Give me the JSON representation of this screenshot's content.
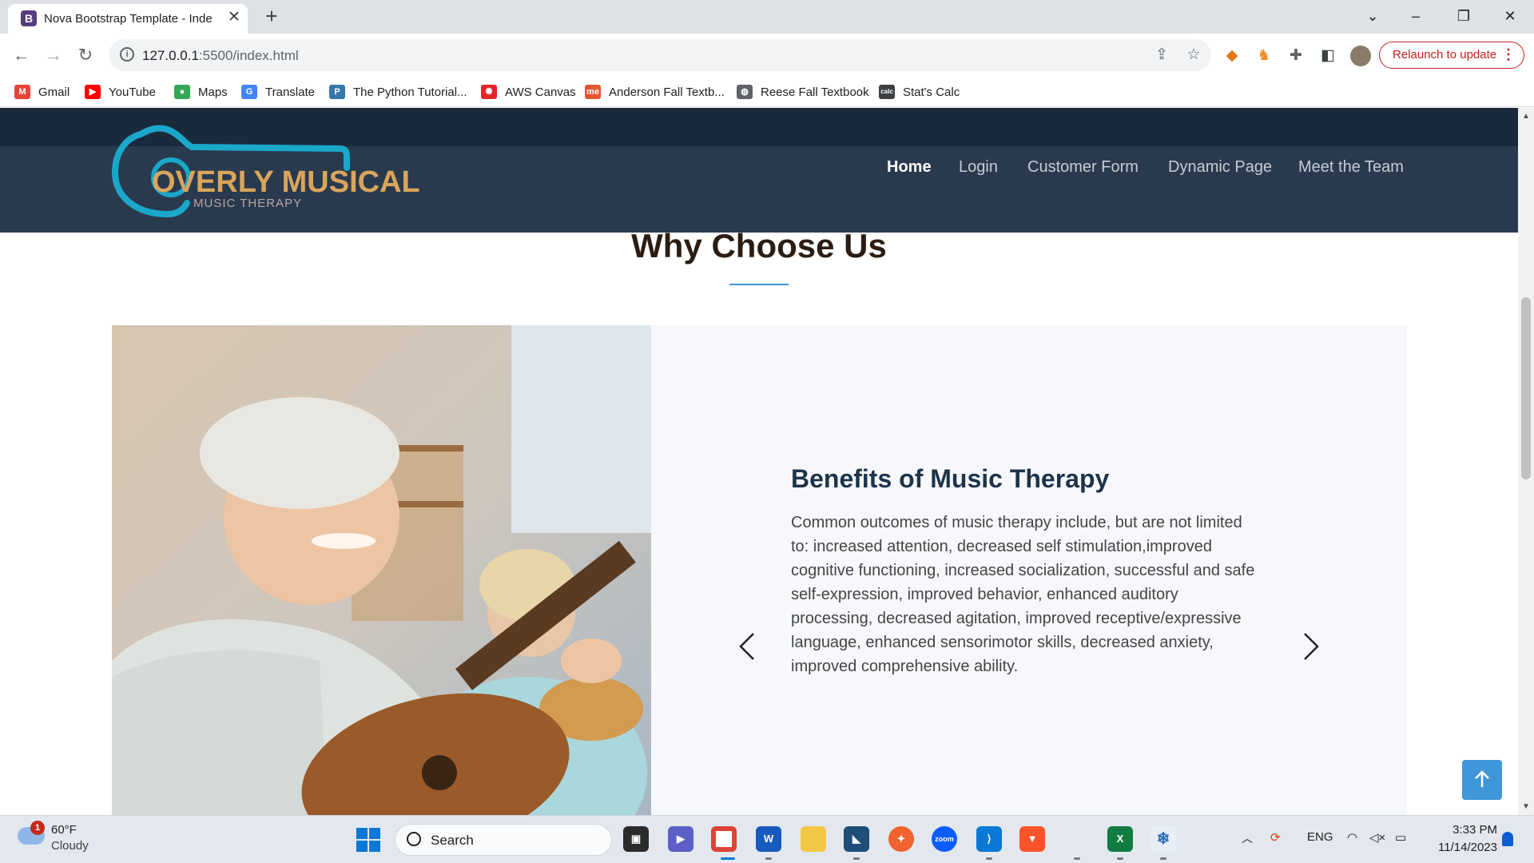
{
  "browser": {
    "tab_title": "Nova Bootstrap Template - Inde",
    "tab_favicon": "B",
    "url_host": "127.0.0.1",
    "url_path": ":5500/index.html",
    "relaunch_label": "Relaunch to update"
  },
  "bookmarks": [
    {
      "label": "Gmail",
      "icon": "gmail-icon",
      "glyph": "M",
      "color": "#ea4335"
    },
    {
      "label": "YouTube",
      "icon": "youtube-icon",
      "glyph": "▶",
      "color": "#ff0000"
    },
    {
      "label": "Maps",
      "icon": "maps-icon",
      "glyph": "●",
      "color": "#34a853"
    },
    {
      "label": "Translate",
      "icon": "translate-icon",
      "glyph": "G",
      "color": "#4285f4"
    },
    {
      "label": "The Python Tutorial...",
      "icon": "python-icon",
      "glyph": "P",
      "color": "#3776ab"
    },
    {
      "label": "AWS Canvas",
      "icon": "canvas-icon",
      "glyph": "✺",
      "color": "#e72429"
    },
    {
      "label": "Anderson Fall Textb...",
      "icon": "mheducation-icon",
      "glyph": "me",
      "color": "#e4572e"
    },
    {
      "label": "Reese Fall Textbook",
      "icon": "globe-icon",
      "glyph": "◍",
      "color": "#5f6368"
    },
    {
      "label": "Stat's Calc",
      "icon": "calculator-icon",
      "glyph": "calc",
      "color": "#3c4043"
    }
  ],
  "site": {
    "logo_text": "OVERLY MUSICAL",
    "logo_subtext": "MUSIC THERAPY",
    "nav": [
      "Home",
      "Login",
      "Customer Form",
      "Dynamic Page",
      "Meet the Team"
    ],
    "active_nav": "Home",
    "section_title": "Why Choose Us",
    "card_title": "Benefits of Music Therapy",
    "card_text": "Common outcomes of music therapy include, but are not limited to: increased attention, decreased self stimulation,improved cognitive functioning, increased socialization, successful and safe self-expression, improved behavior, enhanced auditory processing, decreased agitation, improved receptive/expressive language, enhanced sensorimotor skills, decreased anxiety, improved comprehensive ability."
  },
  "taskbar": {
    "weather_temp": "60°F",
    "weather_condition": "Cloudy",
    "weather_badge": "1",
    "search_label": "Search",
    "language": "ENG",
    "time": "3:33 PM",
    "date": "11/14/2023"
  },
  "colors": {
    "header_bg": "#1d2e43",
    "accent": "#3f96d8",
    "logo_teal": "#1aa7c9",
    "logo_gold": "#d9a55b",
    "relaunch_red": "#c5221f"
  }
}
